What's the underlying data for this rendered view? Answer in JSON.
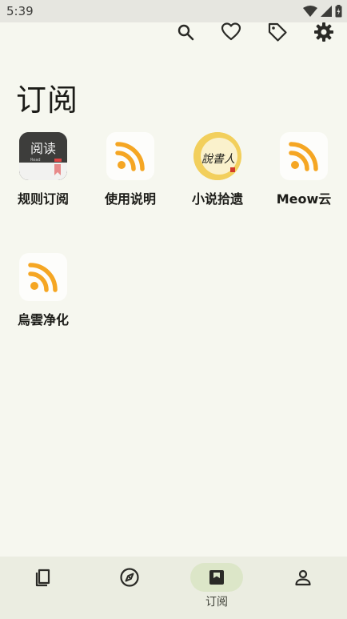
{
  "status_bar": {
    "time": "5:39"
  },
  "toolbar": {
    "search_icon": "search-icon",
    "favorite_icon": "heart-icon",
    "tag_icon": "tag-icon",
    "settings_icon": "gear-icon"
  },
  "page": {
    "title": "订阅"
  },
  "subscriptions": [
    {
      "label": "规则订阅",
      "icon": "legado-app-icon",
      "icon_text": "阅读",
      "icon_subtext": "Read"
    },
    {
      "label": "使用说明",
      "icon": "rss-icon"
    },
    {
      "label": "小说拾遗",
      "icon": "storyteller-icon",
      "icon_text": "說書人"
    },
    {
      "label": "Meow云",
      "icon": "rss-icon"
    },
    {
      "label": "烏雲净化",
      "icon": "rss-icon"
    }
  ],
  "bottom_nav": {
    "items": [
      {
        "icon": "bookshelf-icon",
        "label": ""
      },
      {
        "icon": "compass-icon",
        "label": ""
      },
      {
        "icon": "bookmark-icon",
        "label": "订阅",
        "active": true
      },
      {
        "icon": "person-icon",
        "label": ""
      }
    ]
  },
  "colors": {
    "rss_orange": "#f5a623",
    "active_pill": "#dce6c8",
    "background": "#f6f7ef"
  }
}
